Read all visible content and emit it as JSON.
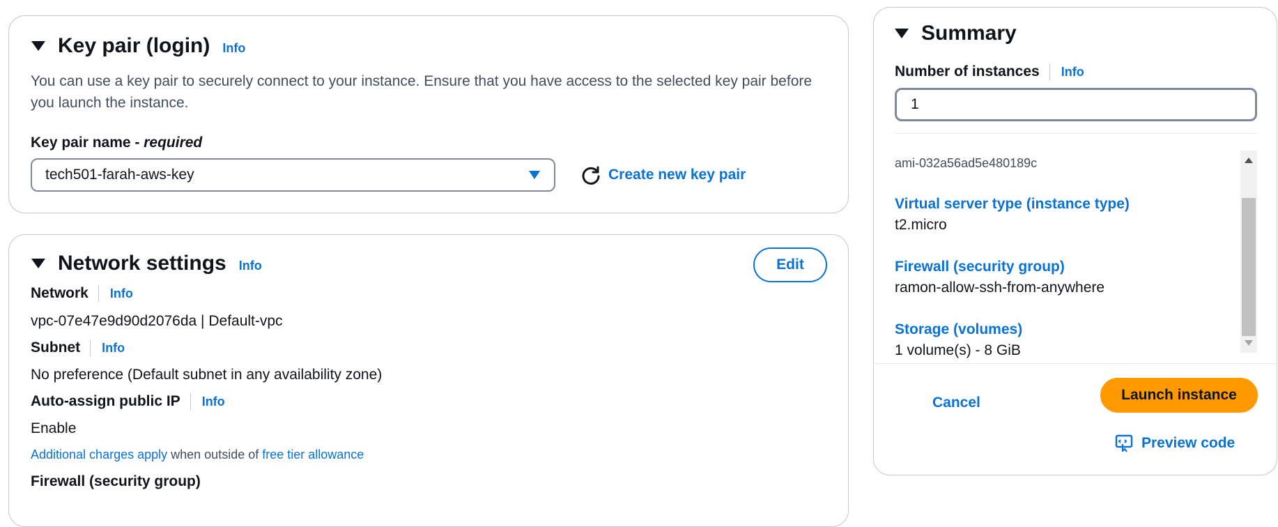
{
  "keypair": {
    "title": "Key pair (login)",
    "info": "Info",
    "description": "You can use a key pair to securely connect to your instance. Ensure that you have access to the selected key pair before you launch the instance.",
    "field_label": "Key pair name - ",
    "field_required": "required",
    "selected": "tech501-farah-aws-key",
    "create_link": "Create new key pair"
  },
  "network": {
    "title": "Network settings",
    "info": "Info",
    "edit_label": "Edit",
    "fields": [
      {
        "label": "Network",
        "info": "Info",
        "value": "vpc-07e47e9d90d2076da | Default-vpc"
      },
      {
        "label": "Subnet",
        "info": "Info",
        "value": "No preference (Default subnet in any availability zone)"
      },
      {
        "label": "Auto-assign public IP",
        "info": "Info",
        "value": "Enable"
      }
    ],
    "note_link1": "Additional charges apply",
    "note_mid": " when outside of ",
    "note_link2": "free tier allowance",
    "next_label_partial": "Firewall (security group)"
  },
  "summary": {
    "title": "Summary",
    "count_label": "Number of instances",
    "count_info": "Info",
    "count_value": "1",
    "ami": "ami-032a56ad5e480189c",
    "items": [
      {
        "title": "Virtual server type (instance type)",
        "value": "t2.micro"
      },
      {
        "title": "Firewall (security group)",
        "value": "ramon-allow-ssh-from-anywhere"
      },
      {
        "title": "Storage (volumes)",
        "value": "1 volume(s) - 8 GiB"
      }
    ],
    "cancel_label": "Cancel",
    "launch_label": "Launch instance",
    "preview_label": "Preview code"
  },
  "colors": {
    "link": "#0972d3",
    "primary_button": "#ff9900",
    "border": "#c6c6cd"
  }
}
